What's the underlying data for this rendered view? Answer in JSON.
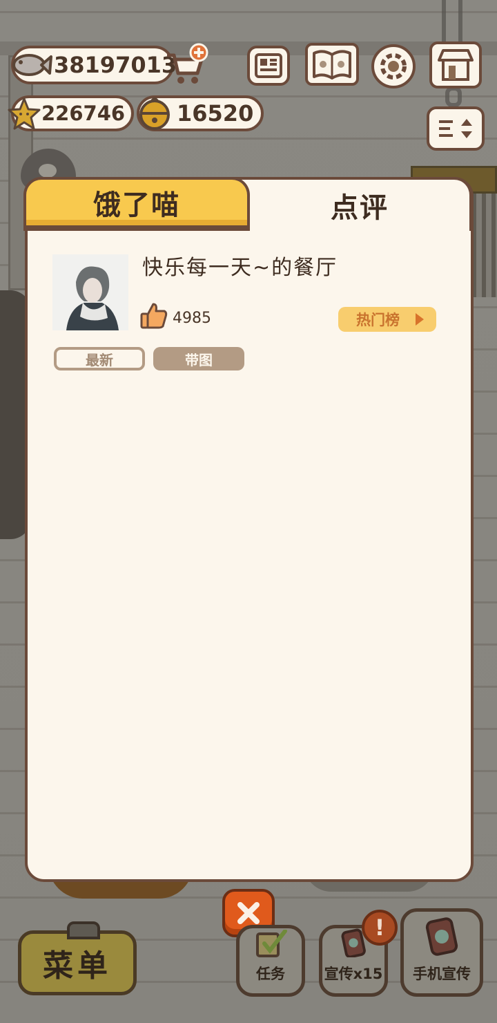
{
  "currency": {
    "fish": "38197013",
    "stars": "226746",
    "bells": "16520"
  },
  "tabs": [
    {
      "label": "饿了喵",
      "active": false
    },
    {
      "label": "点评",
      "active": true
    }
  ],
  "restaurant": {
    "name": "快乐每一天~的餐厅",
    "likes": "4985",
    "hot_list_label": "热门榜"
  },
  "filters": {
    "latest": "最新",
    "with_image": "带图"
  },
  "bottom": {
    "menu": "菜单",
    "tasks": "任务",
    "promo": "宣传x15",
    "phone_promo": "手机宣传"
  },
  "icons": [
    "fish-icon",
    "cart-plus-icon",
    "star-icon",
    "bell-icon",
    "newspaper-icon",
    "paw-book-icon",
    "gear-icon",
    "shop-icon",
    "scroll-toggle-icon",
    "thumbs-up-icon",
    "close-icon",
    "alert-icon"
  ],
  "colors": {
    "panel_bg": "#fcf6ec",
    "border": "#6b4a3a",
    "tab_yellow": "#f8c94e",
    "hot_btn": "#f8cd6e",
    "close": "#e05a1c"
  }
}
